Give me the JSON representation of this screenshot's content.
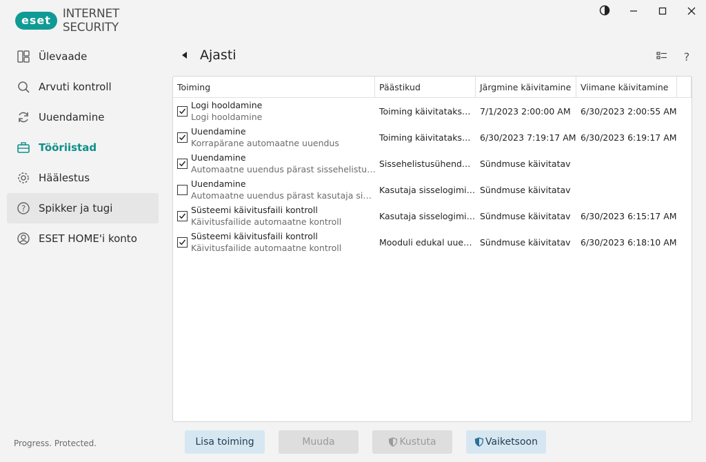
{
  "app": {
    "brand": "eset",
    "product": "INTERNET SECURITY",
    "status": "Progress. Protected.",
    "accent_color": "#0e8f8a"
  },
  "window_controls": [
    {
      "name": "theme-toggle",
      "icon": "contrast-icon"
    },
    {
      "name": "minimize",
      "icon": "minimize-icon"
    },
    {
      "name": "maximize",
      "icon": "maximize-icon"
    },
    {
      "name": "close",
      "icon": "close-icon"
    }
  ],
  "sidebar": {
    "items": [
      {
        "label": "Ülevaade",
        "icon": "dashboard-icon"
      },
      {
        "label": "Arvuti kontroll",
        "icon": "magnifier-icon"
      },
      {
        "label": "Uuendamine",
        "icon": "refresh-icon"
      },
      {
        "label": "Tööriistad",
        "icon": "toolbox-icon",
        "active": true
      },
      {
        "label": "Häälestus",
        "icon": "gear-icon"
      },
      {
        "label": "Spikker ja tugi",
        "icon": "help-icon",
        "hover": true
      },
      {
        "label": "ESET HOME'i konto",
        "icon": "account-icon"
      }
    ]
  },
  "header": {
    "title": "Ajasti"
  },
  "table": {
    "columns": [
      "Toiming",
      "Päästikud",
      "Järgmine käivitamine",
      "Viimane käivitamine"
    ],
    "rows": [
      {
        "checked": true,
        "name": "Logi hooldamine",
        "desc": "Logi hooldamine",
        "trigger": "Toiming käivitatakse ig...",
        "next": "7/1/2023 2:00:00 AM",
        "last": "6/30/2023 2:00:55 AM"
      },
      {
        "checked": true,
        "name": "Uuendamine",
        "desc": "Korrapärane automaatne uuendus",
        "trigger": "Toiming käivitatakse k...",
        "next": "6/30/2023 7:19:17 AM",
        "last": "6/30/2023 6:19:17 AM"
      },
      {
        "checked": true,
        "name": "Uuendamine",
        "desc": "Automaatne uuendus pärast sissehelistusühenduse",
        "trigger": "Sissehelistusühenduse ...",
        "next": "Sündmuse käivitatav",
        "last": ""
      },
      {
        "checked": false,
        "name": "Uuendamine",
        "desc": "Automaatne uuendus pärast kasutaja sisselogimist",
        "trigger": "Kasutaja sisselogimise...",
        "next": "Sündmuse käivitatav",
        "last": ""
      },
      {
        "checked": true,
        "name": "Süsteemi käivitusfaili kontroll",
        "desc": "Käivitusfailide automaatne kontroll",
        "trigger": "Kasutaja sisselogimise...",
        "next": "Sündmuse käivitatav",
        "last": "6/30/2023 6:15:17 AM"
      },
      {
        "checked": true,
        "name": "Süsteemi käivitusfaili kontroll",
        "desc": "Käivitusfailide automaatne kontroll",
        "trigger": "Mooduli edukal uuend...",
        "next": "Sündmuse käivitatav",
        "last": "6/30/2023 6:18:10 AM"
      }
    ]
  },
  "buttons": {
    "add": "Lisa toiming",
    "edit": "Muuda",
    "delete": "Kustuta",
    "default": "Vaiketsoon"
  }
}
